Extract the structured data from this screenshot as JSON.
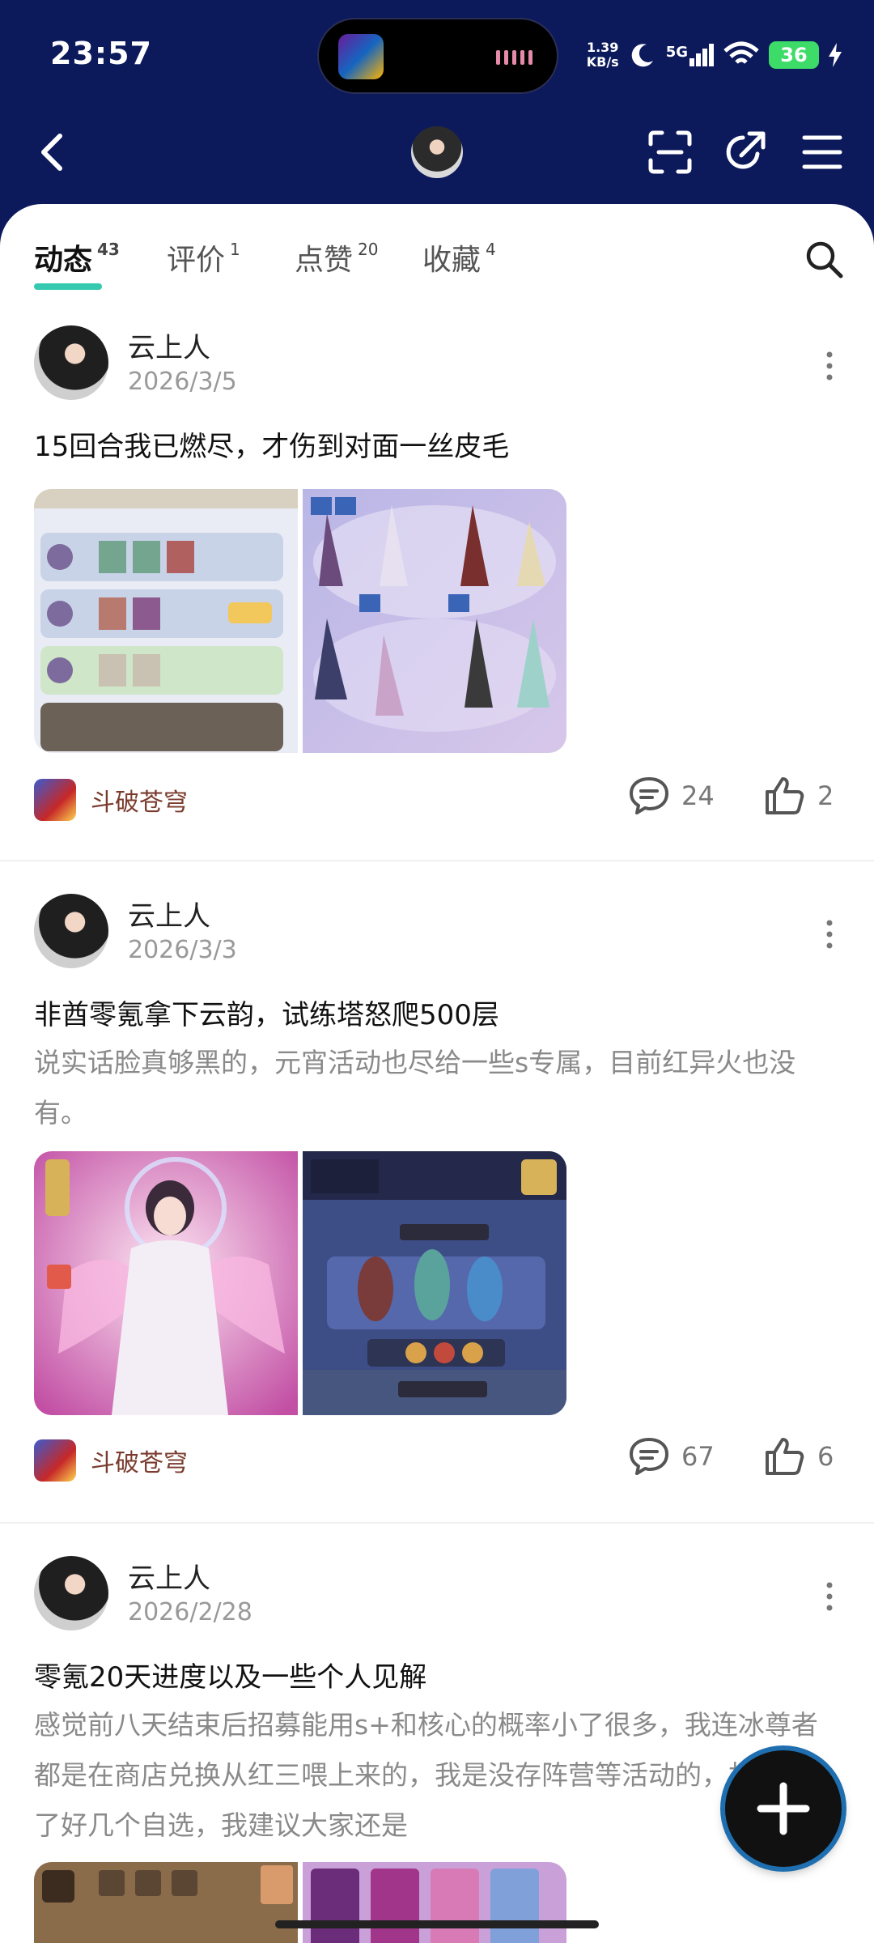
{
  "status_bar": {
    "time": "23:57",
    "net_speed_value": "1.39",
    "net_speed_unit": "KB/s",
    "network": "5G",
    "battery": "36"
  },
  "nav": {
    "back_icon": "back-arrow-icon",
    "scan_icon": "scan-icon",
    "share_icon": "share-icon",
    "menu_icon": "menu-icon"
  },
  "tabs": [
    {
      "label": "动态",
      "count": "43",
      "active": true
    },
    {
      "label": "评价",
      "count": "1"
    },
    {
      "label": "点赞",
      "count": "20"
    },
    {
      "label": "收藏",
      "count": "4"
    }
  ],
  "posts": [
    {
      "author": "云上人",
      "date": "2026/3/5",
      "title": "15回合我已燃尽，才伤到对面一丝皮毛",
      "body": "",
      "game": "斗破苍穹",
      "comments": "24",
      "likes": "2"
    },
    {
      "author": "云上人",
      "date": "2026/3/3",
      "title": "非酋零氪拿下云韵，试练塔怒爬500层",
      "body": "说实话脸真够黑的，元宵活动也尽给一些s专属，目前红异火也没有。",
      "game": "斗破苍穹",
      "comments": "67",
      "likes": "6"
    },
    {
      "author": "云上人",
      "date": "2026/2/28",
      "title": "零氪20天进度以及一些个人见解",
      "body": "感觉前八天结束后招募能用s+和核心的概率小了很多，我连冰尊者都是在商店兑换从红三喂上来的，我是没存阵营等活动的，相当于少了好几个自选，我建议大家还是"
    }
  ],
  "colors": {
    "header_bg": "#0c1a5c",
    "tab_underline": "#35c9b0",
    "game_name": "#7a3b2e"
  }
}
